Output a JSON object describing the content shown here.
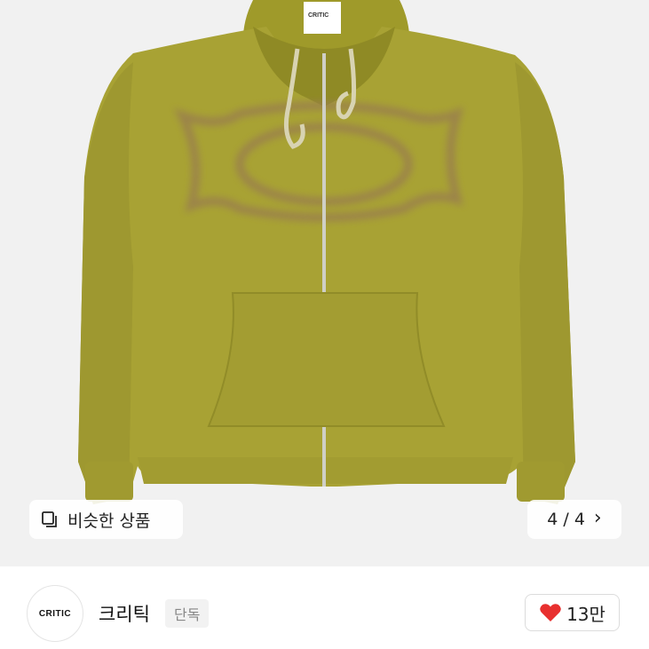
{
  "product_image": {
    "brand_tag": "CRITIC"
  },
  "overlay": {
    "similar_icon": "square-stack-icon",
    "similar_label": "비슷한 상품",
    "page_indicator": "4 / 4",
    "next_icon": "chevron-right-icon"
  },
  "shop": {
    "logo_text": "CRITIC",
    "name": "크리틱",
    "badge": "단독",
    "like_icon": "heart-icon",
    "like_count": "13만",
    "heart_color": "#e8302f"
  }
}
